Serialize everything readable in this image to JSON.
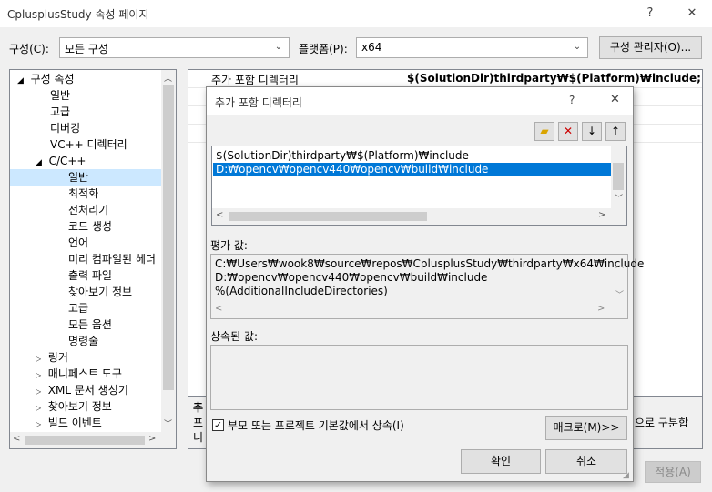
{
  "window": {
    "title": "CplusplusStudy 속성 페이지",
    "help": "?",
    "close": "✕"
  },
  "config": {
    "label": "구성(C):",
    "value": "모든 구성",
    "platform_label": "플랫폼(P):",
    "platform_value": "x64",
    "manager_button": "구성 관리자(O)..."
  },
  "tree": {
    "root": "구성 속성",
    "items": [
      "일반",
      "고급",
      "디버깅",
      "VC++ 디렉터리"
    ],
    "cpp": "C/C++",
    "cpp_items": [
      "일반",
      "최적화",
      "전처리기",
      "코드 생성",
      "언어",
      "미리 컴파일된 헤더",
      "출력 파일",
      "찾아보기 정보",
      "고급",
      "모든 옵션",
      "명령줄"
    ],
    "collapsed": [
      "링커",
      "매니페스트 도구",
      "XML 문서 생성기",
      "찾아보기 정보",
      "빌드 이벤트"
    ]
  },
  "property": {
    "name": "추가 포함 디렉터리",
    "value": "$(SolutionDir)thirdparty₩$(Platform)₩include;%(Addition"
  },
  "description": {
    "line1": "추",
    "line2": "포",
    "line3": "니",
    "right": "으로 구분합"
  },
  "apply_button": "적용(A)",
  "dialog": {
    "title": "추가 포함 디렉터리",
    "help": "?",
    "close": "✕",
    "entries": [
      "$(SolutionDir)thirdparty₩$(Platform)₩include",
      "D:₩opencv₩opencv440₩opencv₩build₩include"
    ],
    "eval_label": "평가 값:",
    "eval_lines": [
      "C:₩Users₩wook8₩source₩repos₩CplusplusStudy₩thirdparty₩x64₩include",
      "D:₩opencv₩opencv440₩opencv₩build₩include",
      "%(AdditionalIncludeDirectories)"
    ],
    "inherited_label": "상속된 값:",
    "inherit_checkbox": "부모 또는 프로젝트 기본값에서 상속(I)",
    "macro_button": "매크로(M)>>",
    "ok_button": "확인",
    "cancel_button": "취소"
  }
}
